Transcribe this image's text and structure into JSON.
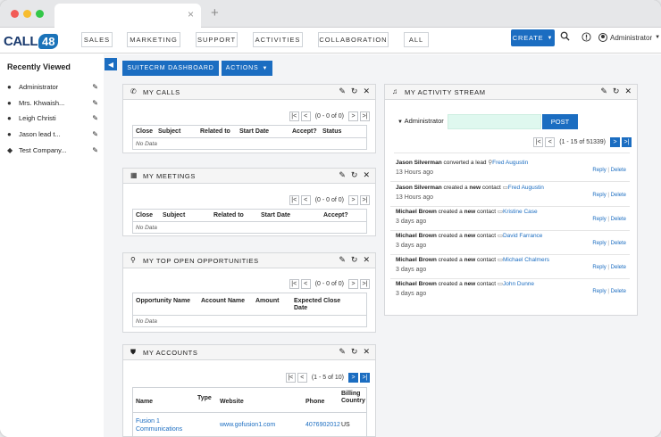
{
  "browser": {
    "tab_close": "×",
    "new_tab": "+"
  },
  "logo": {
    "text": "CALL",
    "number": "48"
  },
  "nav": {
    "items": [
      "SALES",
      "MARKETING",
      "SUPPORT",
      "ACTIVITIES",
      "COLLABORATION",
      "ALL"
    ],
    "create_label": "CREATE",
    "user_name": "Administrator"
  },
  "sidebar": {
    "title": "Recently Viewed",
    "items": [
      {
        "label": "Administrator",
        "icon": "user-icon"
      },
      {
        "label": "Mrs. Khwaish...",
        "icon": "contacts-icon"
      },
      {
        "label": "Leigh Christi",
        "icon": "contacts-icon"
      },
      {
        "label": "Jason lead t...",
        "icon": "lead-icon"
      },
      {
        "label": "Test Company...",
        "icon": "account-icon"
      }
    ]
  },
  "toolbar": {
    "dashboard_label": "SUITECRM DASHBOARD",
    "actions_label": "ACTIONS"
  },
  "calls": {
    "title": "MY CALLS",
    "pager": "(0 - 0 of 0)",
    "columns": [
      "Close",
      "Subject",
      "Related to",
      "Start Date",
      "Accept?",
      "Status"
    ],
    "no_data": "No Data"
  },
  "meetings": {
    "title": "MY MEETINGS",
    "pager": "(0 - 0 of 0)",
    "columns": [
      "Close",
      "Subject",
      "Related to",
      "Start Date",
      "Accept?"
    ],
    "no_data": "No Data"
  },
  "opportunities": {
    "title": "MY TOP OPEN OPPORTUNITIES",
    "pager": "(0 - 0 of 0)",
    "columns": [
      "Opportunity Name",
      "Account Name",
      "Amount",
      "Expected Close",
      "Date"
    ],
    "no_data": "No Data"
  },
  "accounts": {
    "title": "MY ACCOUNTS",
    "pager": "(1 - 5 of 10)",
    "columns": [
      "Name",
      "Type",
      "Website",
      "Phone",
      "Billing",
      "Country"
    ],
    "rows": [
      {
        "name_line1": "Fusion 1",
        "name_line2": "Communications",
        "website": "www.gofusion1.com",
        "phone": "4076902012",
        "country": "US"
      }
    ]
  },
  "stream": {
    "title": "MY ACTIVITY STREAM",
    "input_user": "Administrator",
    "post_label": "POST",
    "pager": "(1 - 15 of 51339)",
    "reply": "Reply",
    "sep": "|",
    "delete": "Delete",
    "items": [
      {
        "actor": "Jason Silverman",
        "verb": "converted",
        "pre": " ",
        "mid": " a lead ",
        "target": "Fred Augustin",
        "time": "13 Hours ago"
      },
      {
        "actor": "Jason Silverman",
        "verb": "new",
        "pre": " created a ",
        "mid": " contact ",
        "target": "Fred Augustin",
        "time": "13 Hours ago"
      },
      {
        "actor": "Michael Brown",
        "verb": "new",
        "pre": " created a ",
        "mid": " contact ",
        "target": "Kristine Case",
        "time": "3 days ago"
      },
      {
        "actor": "Michael Brown",
        "verb": "new",
        "pre": " created a ",
        "mid": " contact ",
        "target": "David Farrance",
        "time": "3 days ago"
      },
      {
        "actor": "Michael Brown",
        "verb": "new",
        "pre": " created a ",
        "mid": " contact ",
        "target": "Michael Chalmers",
        "time": "3 days ago"
      },
      {
        "actor": "Michael Brown",
        "verb": "new",
        "pre": " created a ",
        "mid": " contact ",
        "target": "John Dunne",
        "time": "3 days ago"
      }
    ]
  }
}
